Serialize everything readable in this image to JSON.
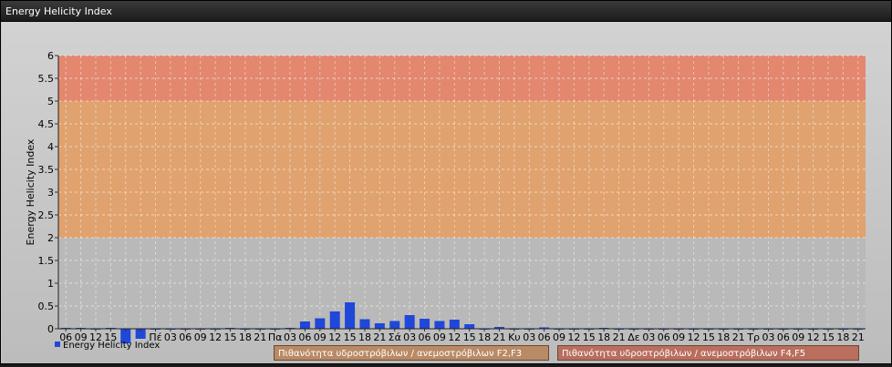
{
  "window": {
    "title": "Energy Helicity Index"
  },
  "colors": {
    "bar": "#1f47d8",
    "band_low": "#b9b9b9",
    "band_mid": "#e0a26e",
    "band_high": "#e3876e"
  },
  "legend": {
    "series_label": "Energy Helicity Index",
    "risk_f2f3": "Πιθανότητα υδροστρόβιλων / ανεμοστρόβιλων F2,F3",
    "risk_f4f5": "Πιθανότητα υδροστρόβιλων / ανεμοστρόβιλων F4,F5"
  },
  "chart_data": {
    "type": "bar",
    "title": "",
    "ylabel": "Energy Helicity Index",
    "xlabel": "",
    "ylim": [
      0,
      6
    ],
    "yticks": [
      "0",
      "0.5",
      "1",
      "1.5",
      "2",
      "2.5",
      "3",
      "3.5",
      "4",
      "4.5",
      "5",
      "5.5",
      "6"
    ],
    "bands": [
      {
        "from": 0,
        "to": 2,
        "color": "#b9b9b9"
      },
      {
        "from": 2,
        "to": 5,
        "color": "#e0a26e"
      },
      {
        "from": 5,
        "to": 6,
        "color": "#e3876e"
      }
    ],
    "categories": [
      "06",
      "09",
      "12",
      "15",
      "",
      "",
      "Πέ",
      "03",
      "06",
      "09",
      "12",
      "15",
      "18",
      "21",
      "Πα",
      "03",
      "06",
      "09",
      "12",
      "15",
      "18",
      "21",
      "Σά",
      "03",
      "06",
      "09",
      "12",
      "15",
      "18",
      "21",
      "Κυ",
      "03",
      "06",
      "09",
      "12",
      "15",
      "18",
      "21",
      "Δε",
      "03",
      "06",
      "09",
      "12",
      "15",
      "18",
      "21",
      "Τρ",
      "03",
      "06",
      "09",
      "12",
      "15",
      "18",
      "21"
    ],
    "series": [
      {
        "name": "Energy Helicity Index",
        "values": [
          0.02,
          0.02,
          0.01,
          0.02,
          -0.32,
          -0.22,
          0.01,
          0.01,
          0.01,
          0.01,
          0.01,
          0.02,
          0.01,
          0.01,
          0.01,
          0.02,
          0.16,
          0.23,
          0.38,
          0.58,
          0.21,
          0.12,
          0.17,
          0.3,
          0.22,
          0.17,
          0.2,
          0.1,
          0.01,
          0.04,
          0.01,
          0.01,
          0.03,
          0.01,
          0.01,
          0.01,
          0.02,
          0.01,
          0.01,
          0.01,
          0.01,
          0.01,
          0.01,
          0.01,
          0.01,
          0.01,
          0.01,
          0.01,
          0.01,
          0.01,
          0.01,
          0.01,
          0.01,
          0.01
        ]
      }
    ]
  }
}
